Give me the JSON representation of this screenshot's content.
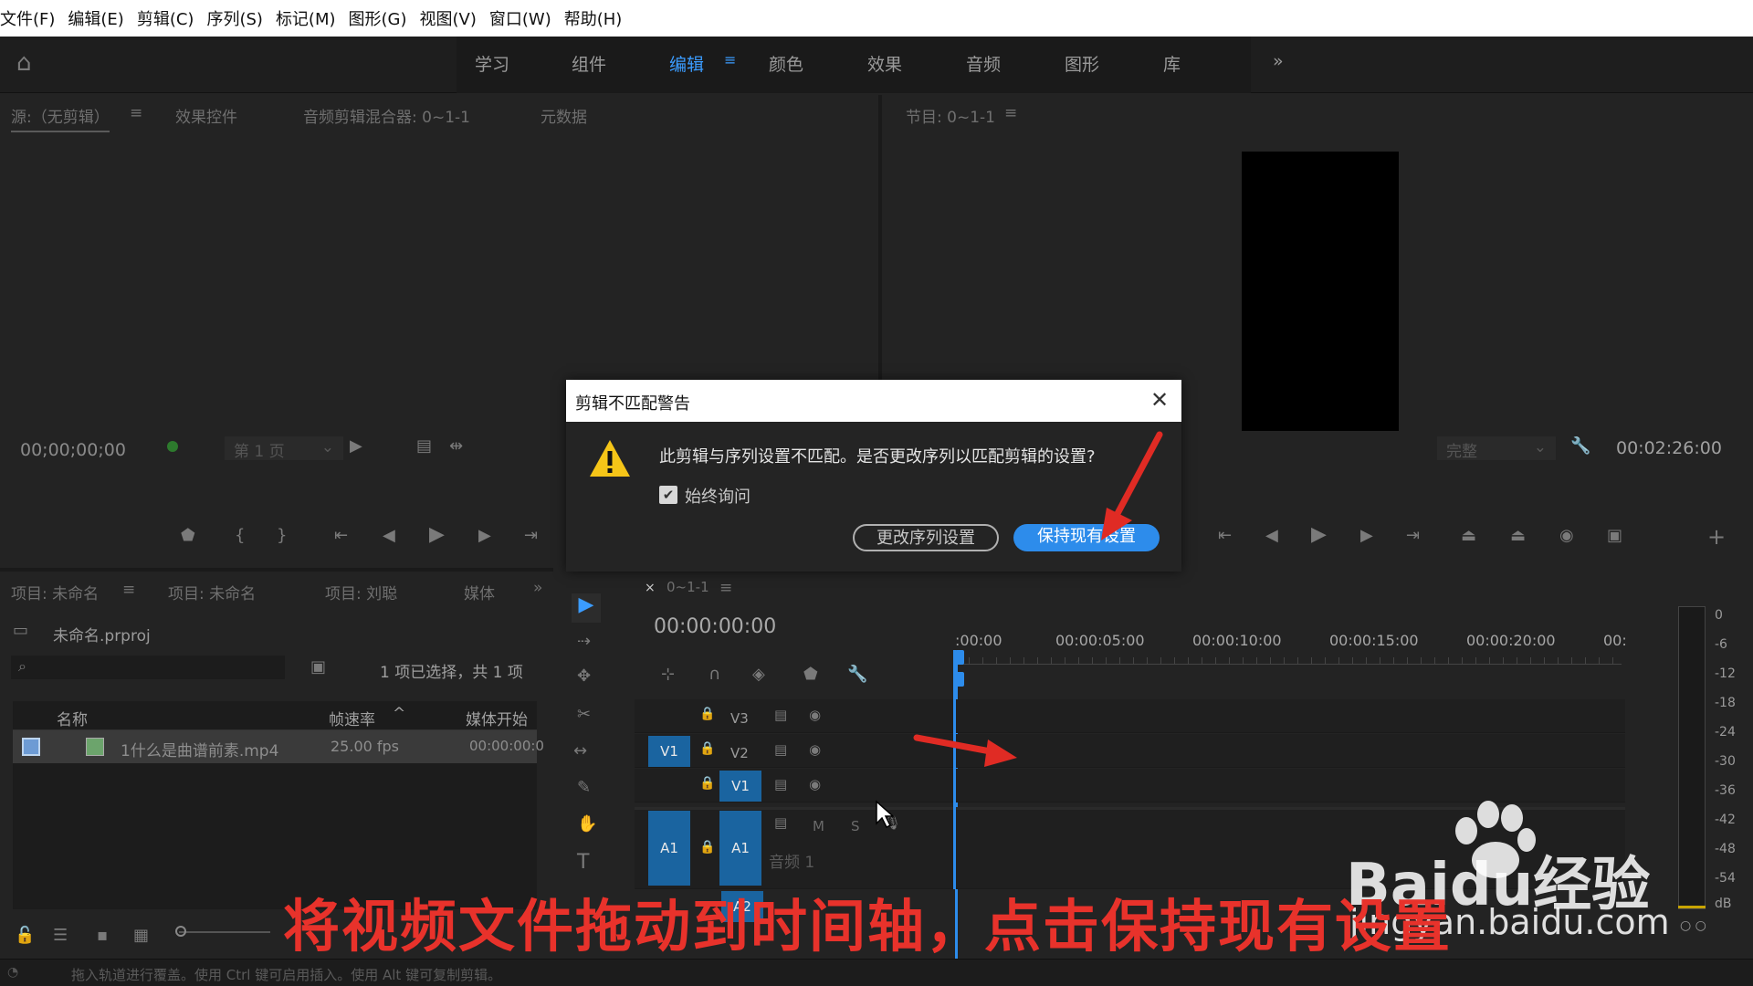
{
  "menu": [
    "文件(F)",
    "编辑(E)",
    "剪辑(C)",
    "序列(S)",
    "标记(M)",
    "图形(G)",
    "视图(V)",
    "窗口(W)",
    "帮助(H)"
  ],
  "workspaces": [
    "学习",
    "组件",
    "编辑",
    "颜色",
    "效果",
    "音频",
    "图形",
    "库"
  ],
  "source_tabs": {
    "source": "源:（无剪辑）",
    "effects": "效果控件",
    "audio_mixer": "音频剪辑混合器: 0~1-1",
    "metadata": "元数据"
  },
  "source": {
    "timecode": "00;00;00;00",
    "page": "第 1 页"
  },
  "program": {
    "tab": "节目: 0~1-1",
    "fit": "完整",
    "timecode": "00:02:26:00"
  },
  "dialog": {
    "title": "剪辑不匹配警告",
    "message": "此剪辑与序列设置不匹配。是否更改序列以匹配剪辑的设置?",
    "checkbox": "始终询问",
    "btn_change": "更改序列设置",
    "btn_keep": "保持现有设置"
  },
  "project_tabs": [
    "项目: 未命名",
    "项目: 未命名",
    "项目: 刘聪",
    "媒体"
  ],
  "project": {
    "file": "未命名.prproj",
    "selection": "1 项已选择，共 1 项",
    "col_name": "名称",
    "col_fps": "帧速率",
    "col_start": "媒体开始",
    "row_name": "1什么是曲谱前素.mp4",
    "row_fps": "25.00 fps",
    "row_start": "00:00:00:0"
  },
  "timeline": {
    "tab": "0~1-1",
    "timecode": "00:00:00:00",
    "ruler": [
      ":00:00",
      "00:00:05:00",
      "00:00:10:00",
      "00:00:15:00",
      "00:00:20:00",
      "00:"
    ],
    "tracks": {
      "v3": "V3",
      "v2": "V2",
      "v1": "V1",
      "a1": "A1",
      "src_v1": "V1",
      "src_a1": "A1",
      "a2": "A2",
      "audio_name": "音频 1",
      "m": "M",
      "s": "S"
    }
  },
  "meter": [
    "0",
    "-6",
    "-12",
    "-18",
    "-24",
    "-30",
    "-36",
    "-42",
    "-48",
    "-54",
    "dB"
  ],
  "status": "拖入轨道进行覆盖。使用 Ctrl 键可启用插入。使用 Alt 键可复制剪辑。",
  "watermark": {
    "brand": "Baidu经验",
    "url": "jingyan.baidu.com"
  },
  "caption": "将视频文件拖动到时间轴，点击保持现有设置",
  "colors": {
    "accent": "#2d8ceb",
    "caption": "#e8322b",
    "arrow": "#e02b24"
  }
}
